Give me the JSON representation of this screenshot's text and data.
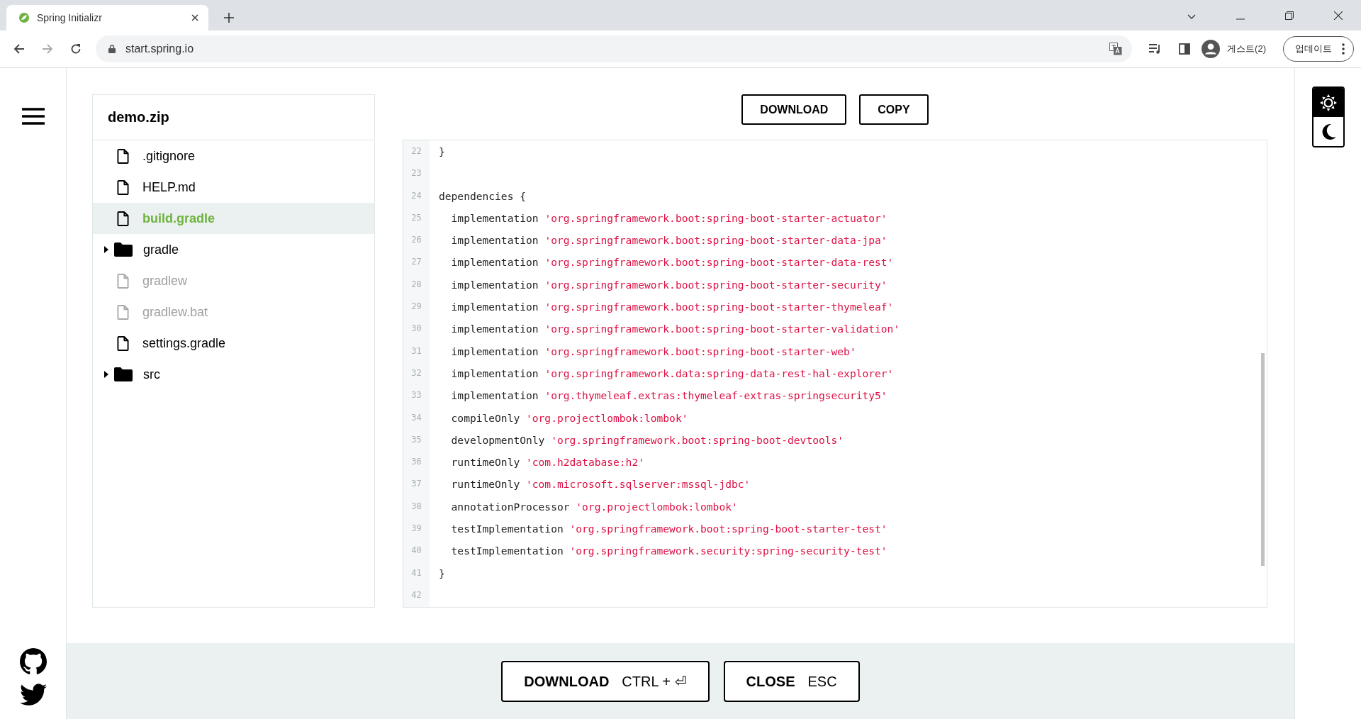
{
  "browser": {
    "tab_title": "Spring Initializr",
    "url": "start.spring.io",
    "profile": "게스트(2)",
    "update_button": "업데이트"
  },
  "archive": {
    "title": "demo.zip",
    "files": [
      {
        "name": ".gitignore",
        "kind": "file",
        "selected": false,
        "disabled": false
      },
      {
        "name": "HELP.md",
        "kind": "file",
        "selected": false,
        "disabled": false
      },
      {
        "name": "build.gradle",
        "kind": "file",
        "selected": true,
        "disabled": false
      },
      {
        "name": "gradle",
        "kind": "folder",
        "selected": false,
        "expanded": false
      },
      {
        "name": "gradlew",
        "kind": "file",
        "selected": false,
        "disabled": true
      },
      {
        "name": "gradlew.bat",
        "kind": "file",
        "selected": false,
        "disabled": true
      },
      {
        "name": "settings.gradle",
        "kind": "file",
        "selected": false,
        "disabled": false
      },
      {
        "name": "src",
        "kind": "folder",
        "selected": false,
        "expanded": false
      }
    ]
  },
  "actions": [
    "DOWNLOAD",
    "COPY"
  ],
  "code_lines": [
    {
      "number": "22",
      "text": "}"
    },
    {
      "number": "23"
    },
    {
      "number": "24",
      "text": "dependencies {"
    },
    {
      "number": "25",
      "text": "  implementation ",
      "string": "'org.springframework.boot:spring-boot-starter-actuator'"
    },
    {
      "number": "26",
      "text": "  implementation ",
      "string": "'org.springframework.boot:spring-boot-starter-data-jpa'"
    },
    {
      "number": "27",
      "text": "  implementation ",
      "string": "'org.springframework.boot:spring-boot-starter-data-rest'"
    },
    {
      "number": "28",
      "text": "  implementation ",
      "string": "'org.springframework.boot:spring-boot-starter-security'"
    },
    {
      "number": "29",
      "text": "  implementation ",
      "string": "'org.springframework.boot:spring-boot-starter-thymeleaf'"
    },
    {
      "number": "30",
      "text": "  implementation ",
      "string": "'org.springframework.boot:spring-boot-starter-validation'"
    },
    {
      "number": "31",
      "text": "  implementation ",
      "string": "'org.springframework.boot:spring-boot-starter-web'"
    },
    {
      "number": "32",
      "text": "  implementation ",
      "string": "'org.springframework.data:spring-data-rest-hal-explorer'"
    },
    {
      "number": "33",
      "text": "  implementation ",
      "string": "'org.thymeleaf.extras:thymeleaf-extras-springsecurity5'"
    },
    {
      "number": "34",
      "text": "  compileOnly ",
      "string": "'org.projectlombok:lombok'"
    },
    {
      "number": "35",
      "text": "  developmentOnly ",
      "string": "'org.springframework.boot:spring-boot-devtools'"
    },
    {
      "number": "36",
      "text": "  runtimeOnly ",
      "string": "'com.h2database:h2'"
    },
    {
      "number": "37",
      "text": "  runtimeOnly ",
      "string": "'com.microsoft.sqlserver:mssql-jdbc'"
    },
    {
      "number": "38",
      "text": "  annotationProcessor ",
      "string": "'org.projectlombok:lombok'"
    },
    {
      "number": "39",
      "text": "  testImplementation ",
      "string": "'org.springframework.boot:spring-boot-starter-test'"
    },
    {
      "number": "40",
      "text": "  testImplementation ",
      "string": "'org.springframework.security:spring-security-test'"
    },
    {
      "number": "41",
      "text": "}"
    },
    {
      "number": "42"
    }
  ],
  "footer_buttons": [
    {
      "label": "DOWNLOAD",
      "shortcut": "CTRL + ⏎"
    },
    {
      "label": "CLOSE",
      "shortcut": "ESC"
    }
  ],
  "theme_toggle": [
    {
      "kind": "light",
      "selected": true
    },
    {
      "kind": "dark",
      "selected": false
    }
  ]
}
